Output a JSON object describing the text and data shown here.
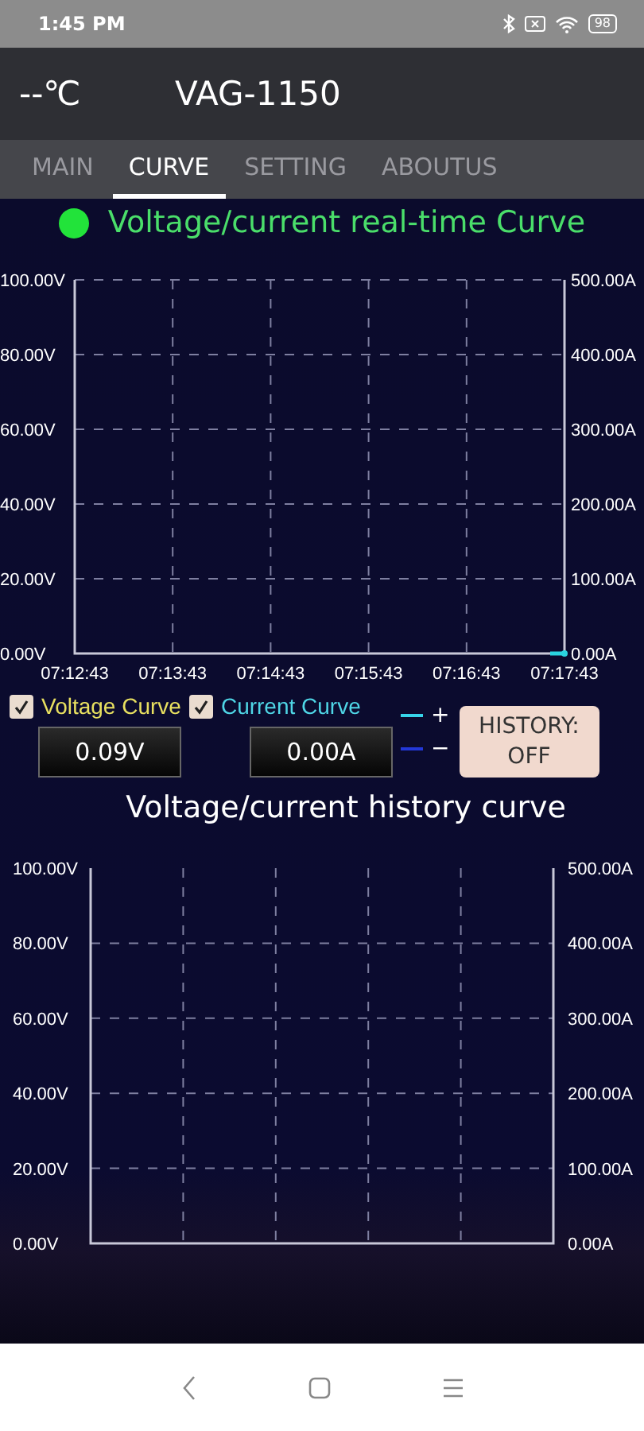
{
  "status_bar": {
    "time": "1:45 PM",
    "battery": "98"
  },
  "header": {
    "temperature": "--℃",
    "device": "VAG-1150"
  },
  "tabs": [
    {
      "label": "MAIN",
      "selected": false
    },
    {
      "label": "CURVE",
      "selected": true
    },
    {
      "label": "SETTING",
      "selected": false
    },
    {
      "label": "ABOUTUS",
      "selected": false
    }
  ],
  "realtime": {
    "connected": true,
    "title": "Voltage/current real-time Curve",
    "right_labels": [
      "500.00A",
      "400.00A",
      "300.00A",
      "200.00A",
      "100.00A",
      "0.00A"
    ],
    "chart_data": {
      "type": "line",
      "x": [
        "07:12:43",
        "07:13:43",
        "07:14:43",
        "07:15:43",
        "07:16:43",
        "07:17:43"
      ],
      "ylim": [
        0,
        100
      ],
      "yticks": [
        {
          "value": 100,
          "label": "100.00V"
        },
        {
          "value": 80,
          "label": "80.00V"
        },
        {
          "value": 60,
          "label": "60.00V"
        },
        {
          "value": 40,
          "label": "40.00V"
        },
        {
          "value": 20,
          "label": "20.00V"
        },
        {
          "value": 0,
          "label": "0.00V"
        }
      ],
      "grid": true,
      "series": [
        {
          "color": "#2ad4e0",
          "marker": true,
          "values": [
            null,
            null,
            null,
            null,
            null,
            0
          ]
        }
      ]
    }
  },
  "controls": {
    "checkboxes": [
      {
        "label": "Voltage Curve",
        "checked": true,
        "color": "#e8e060"
      },
      {
        "label": "Current Curve",
        "checked": true,
        "color": "#4fd6e6"
      }
    ],
    "readings": [
      "0.09V",
      "0.00A"
    ],
    "legend": [
      {
        "sign": "+",
        "color": "#37d4ea"
      },
      {
        "sign": "−",
        "color": "#2338d8"
      }
    ],
    "history_button": {
      "line1": "HISTORY:",
      "line2": "OFF"
    }
  },
  "history": {
    "title": "Voltage/current history curve",
    "right_labels": [
      "500.00A",
      "400.00A",
      "300.00A",
      "200.00A",
      "100.00A",
      "0.00A"
    ],
    "left_labels": [
      "100.00V",
      "80.00V",
      "60.00V",
      "40.00V",
      "20.00V",
      "0.00V"
    ]
  }
}
